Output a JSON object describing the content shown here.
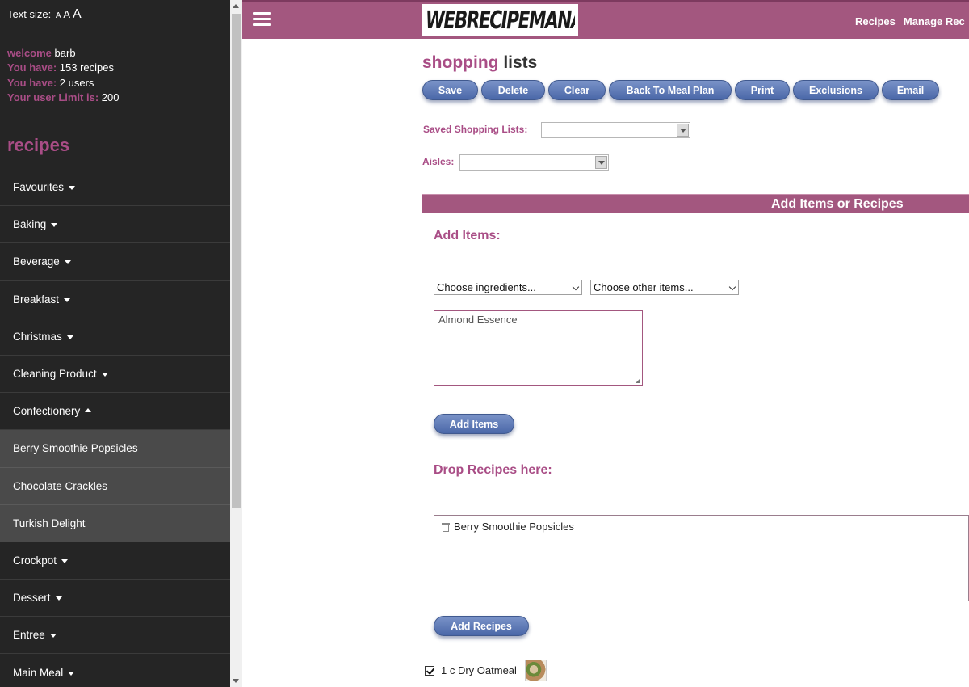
{
  "sidebar": {
    "text_size_label": "Text size:",
    "text_size_options": [
      "A",
      "A",
      "A"
    ],
    "welcome_label": "welcome",
    "welcome_user": "barb",
    "recipes_label": "You have:",
    "recipes_value": "153 recipes",
    "users_label": "You have:",
    "users_value": "2 users",
    "limit_label": "Your user Limit is:",
    "limit_value": "200",
    "title": "recipes",
    "items": [
      {
        "label": "Favourites",
        "caret": "down"
      },
      {
        "label": "Baking",
        "caret": "down"
      },
      {
        "label": "Beverage",
        "caret": "down"
      },
      {
        "label": "Breakfast",
        "caret": "down"
      },
      {
        "label": "Christmas",
        "caret": "down"
      },
      {
        "label": "Cleaning Product",
        "caret": "down"
      },
      {
        "label": "Confectionery",
        "caret": "up"
      },
      {
        "label": "Berry Smoothie Popsicles",
        "sub": true
      },
      {
        "label": "Chocolate Crackles",
        "sub": true
      },
      {
        "label": "Turkish Delight",
        "sub": true
      },
      {
        "label": "Crockpot",
        "caret": "down"
      },
      {
        "label": "Dessert",
        "caret": "down"
      },
      {
        "label": "Entree",
        "caret": "down"
      },
      {
        "label": "Main Meal",
        "caret": "down"
      }
    ]
  },
  "header": {
    "logo_text": "WEBRECIPEMANAGER",
    "nav": [
      "Recipes",
      "Manage Rec"
    ]
  },
  "main": {
    "title_part1": "shopping",
    "title_part2": "lists",
    "buttons": {
      "save": "Save",
      "delete": "Delete",
      "clear": "Clear",
      "back": "Back To Meal Plan",
      "print": "Print",
      "exclusions": "Exclusions",
      "email": "Email"
    },
    "saved_lists_label": "Saved Shopping Lists:",
    "saved_lists_value": "",
    "aisles_label": "Aisles:",
    "aisles_value": "",
    "section_title": "Add Items or Recipes",
    "add_items_heading": "Add Items:",
    "ingredients_select": "Choose ingredients...",
    "other_items_select": "Choose other items...",
    "items_text": "Almond Essence",
    "add_items_button": "Add Items",
    "drop_heading": "Drop Recipes here:",
    "dropped_recipe": "Berry Smoothie Popsicles",
    "add_recipes_button": "Add Recipes",
    "list_item": "1 c Dry Oatmeal"
  },
  "colors": {
    "accent": "#a3577f",
    "accent_text": "#a94d86",
    "sidebar_bg": "#252525",
    "button_blue": "#5a76b5"
  }
}
